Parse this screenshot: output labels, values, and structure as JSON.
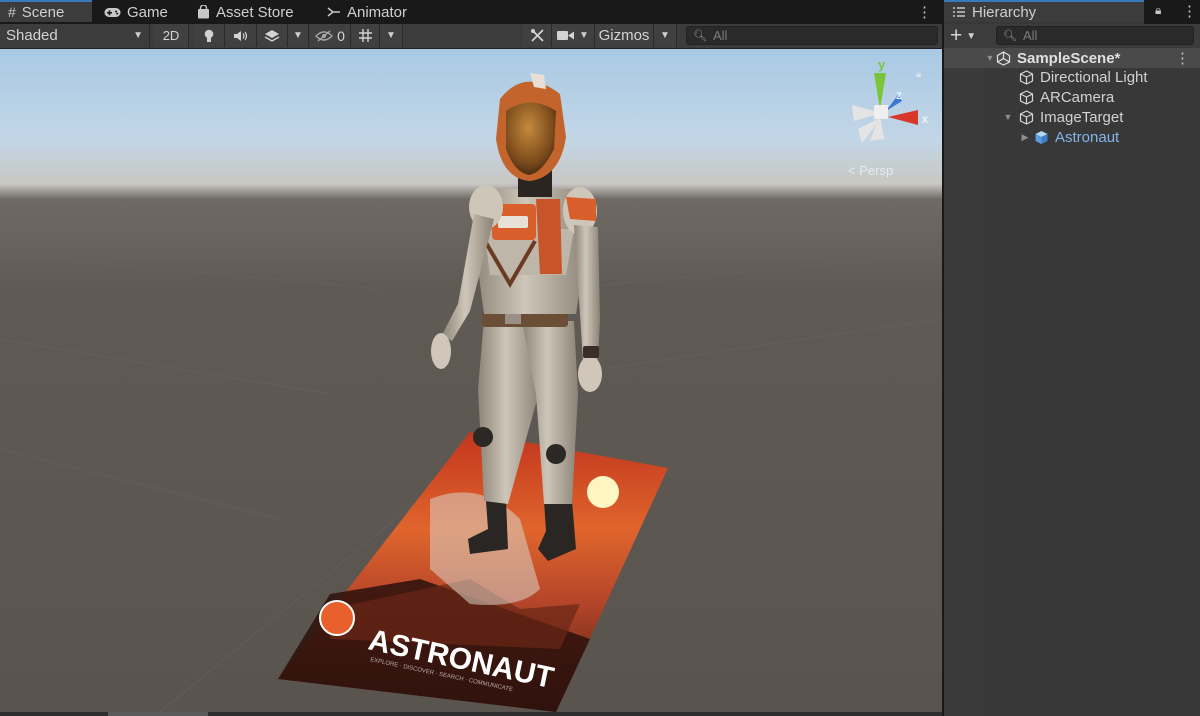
{
  "tabs": [
    {
      "label": "Scene",
      "icon": "grid-icon",
      "active": true
    },
    {
      "label": "Game",
      "icon": "gamepad-icon",
      "active": false
    },
    {
      "label": "Asset Store",
      "icon": "store-bag-icon",
      "active": false
    },
    {
      "label": "Animator",
      "icon": "animator-icon",
      "active": false
    }
  ],
  "toolbar": {
    "shading_mode": "Shaded",
    "mode_2d": "2D",
    "hidden_count": "0",
    "gizmos_label": "Gizmos",
    "search_placeholder": "All"
  },
  "scene_gizmo": {
    "x_label": "x",
    "y_label": "y",
    "z_label": "z",
    "projection": "Persp",
    "x_color": "#d8372a",
    "y_color": "#7ac53a",
    "z_color": "#3a76d2"
  },
  "image_target": {
    "title": "ASTRONAUT",
    "subtitle": "EXPLORE · DISCOVER · SEARCH · COMMUNICATE"
  },
  "hierarchy": {
    "tab_label": "Hierarchy",
    "search_placeholder": "All",
    "scene_name": "SampleScene*",
    "items": [
      {
        "label": "Directional Light"
      },
      {
        "label": "ARCamera"
      },
      {
        "label": "ImageTarget"
      },
      {
        "label": "Astronaut"
      }
    ],
    "prefab_color": "#84b4e8"
  },
  "colors": {
    "accent": "#3a79bb",
    "panel": "#383838",
    "toolbar": "#3c3c3c"
  }
}
